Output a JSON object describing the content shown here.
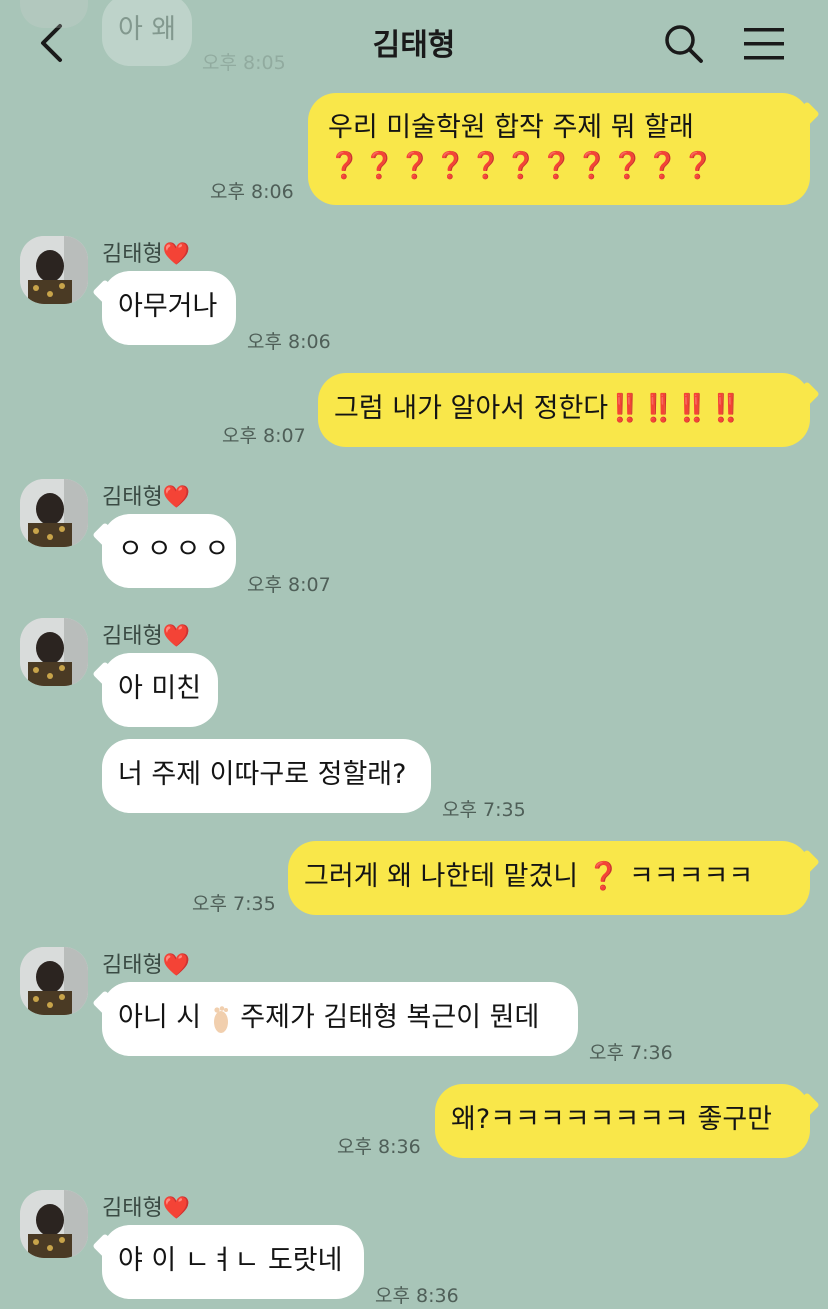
{
  "header": {
    "title": "김태형"
  },
  "messages": {
    "m0": {
      "text": "아 왜",
      "time": "오후 8:05"
    },
    "m1": {
      "line1": "우리 미술학원 합작 주제 뭐 할래",
      "line2": "❓❓❓❓❓❓❓❓❓❓❓",
      "time": "오후 8:06"
    },
    "s1": {
      "name": "김태형",
      "heart": "❤️"
    },
    "m2": {
      "text": "아무거나",
      "time": "오후 8:06"
    },
    "m3": {
      "text": "그럼 내가 알아서 정한다",
      "emoji": "‼️‼️‼️‼️",
      "time": "오후 8:07"
    },
    "s2": {
      "name": "김태형",
      "heart": "❤️"
    },
    "m4": {
      "text": "ㅇㅇㅇㅇ",
      "time": "오후 8:07"
    },
    "s3": {
      "name": "김태형",
      "heart": "❤️"
    },
    "m5": {
      "text": "아 미친"
    },
    "m6": {
      "text": "너 주제 이따구로 정할래?",
      "time": "오후 7:35"
    },
    "m7": {
      "text_before": "그러게 왜 나한테 맡겼니",
      "emoji": "❓",
      "text_after": "ㅋㅋㅋㅋㅋ",
      "time": "오후 7:35"
    },
    "s4": {
      "name": "김태형",
      "heart": "❤️"
    },
    "m8": {
      "text_before": "아니 시",
      "text_after": "주제가 김태형 복근이 뭔데",
      "time": "오후 7:36"
    },
    "m9": {
      "text": "왜?ㅋㅋㅋㅋㅋㅋㅋㅋ 좋구만",
      "time": "오후 8:36"
    },
    "s5": {
      "name": "김태형",
      "heart": "❤️"
    },
    "m10": {
      "text": "야 이 ㄴㅕㄴ 도랏네",
      "time": "오후 8:36"
    }
  },
  "colors": {
    "background": "#a8c5b8",
    "incoming_bubble": "#ffffff",
    "outgoing_bubble": "#f9e74a",
    "accent_red": "#d8202a"
  },
  "icons": {
    "back": "chevron-left-icon",
    "search": "search-icon",
    "menu": "hamburger-menu-icon",
    "foot": "foot-emoji-icon"
  }
}
